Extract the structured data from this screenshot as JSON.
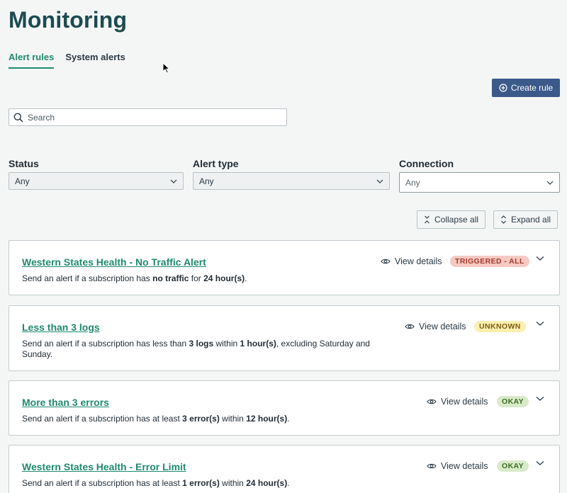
{
  "page": {
    "title": "Monitoring"
  },
  "tabs": [
    {
      "label": "Alert rules",
      "active": true
    },
    {
      "label": "System alerts",
      "active": false
    }
  ],
  "toolbar": {
    "create_label": "Create rule"
  },
  "search": {
    "placeholder": "Search"
  },
  "filters": {
    "status": {
      "label": "Status",
      "value": "Any"
    },
    "alert_type": {
      "label": "Alert type",
      "value": "Any"
    },
    "connection": {
      "label": "Connection",
      "value": "Any"
    }
  },
  "actions": {
    "collapse_label": "Collapse all",
    "expand_label": "Expand all"
  },
  "rules": [
    {
      "title": "Western States Health - No Traffic Alert",
      "desc_parts": [
        "Send an alert if a subscription has ",
        "no traffic",
        " for ",
        "24 hour(s)",
        "."
      ],
      "view_label": "View details",
      "status": "TRIGGERED - ALL",
      "status_color": "#f6c9c3",
      "status_text_color": "#a33a2c"
    },
    {
      "title": "Less than 3 logs",
      "desc_parts": [
        "Send an alert if a subscription has less than ",
        "3 logs",
        " within ",
        "1 hour(s)",
        ", excluding Saturday and Sunday."
      ],
      "view_label": "View details",
      "status": "UNKNOWN",
      "status_color": "#fbefb0",
      "status_text_color": "#7a5e10"
    },
    {
      "title": "More than 3 errors",
      "desc_parts": [
        "Send an alert if a subscription has at least ",
        "3 error(s)",
        " within ",
        "12 hour(s)",
        "."
      ],
      "view_label": "View details",
      "status": "OKAY",
      "status_color": "#d8ebc9",
      "status_text_color": "#3e6b24"
    },
    {
      "title": "Western States Health - Error Limit",
      "desc_parts": [
        "Send an alert if a subscription has at least ",
        "1 error(s)",
        " within ",
        "24 hour(s)",
        "."
      ],
      "view_label": "View details",
      "status": "OKAY",
      "status_color": "#d8ebc9",
      "status_text_color": "#3e6b24"
    }
  ]
}
